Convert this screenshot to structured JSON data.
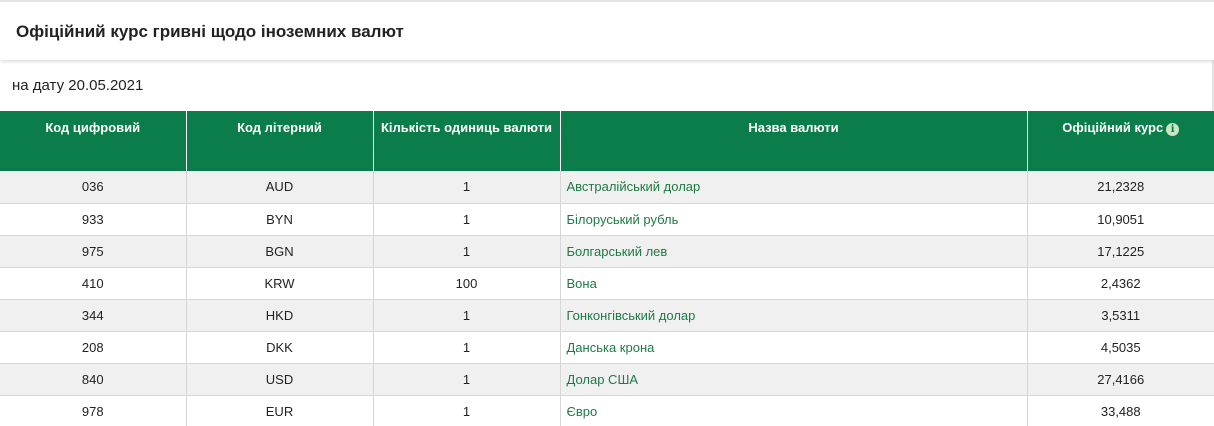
{
  "header": {
    "title": "Офіційний курс гривні щодо іноземних валют"
  },
  "date_line": "на дату 20.05.2021",
  "colors": {
    "header_green": "#0b7d4a",
    "link_green": "#1f7a45",
    "row_stripe": "#f0f0f0"
  },
  "table": {
    "columns": [
      "Код цифровий",
      "Код літерний",
      "Кількість одиниць валюти",
      "Назва валюти",
      "Офіційний курс"
    ],
    "info_icon": "info-icon",
    "info_glyph": "i",
    "rows": [
      {
        "code_num": "036",
        "code_alpha": "AUD",
        "units": "1",
        "name": "Австралійський долар",
        "rate": "21,2328"
      },
      {
        "code_num": "933",
        "code_alpha": "BYN",
        "units": "1",
        "name": "Білоруський рубль",
        "rate": "10,9051"
      },
      {
        "code_num": "975",
        "code_alpha": "BGN",
        "units": "1",
        "name": "Болгарський лев",
        "rate": "17,1225"
      },
      {
        "code_num": "410",
        "code_alpha": "KRW",
        "units": "100",
        "name": "Вона",
        "rate": "2,4362"
      },
      {
        "code_num": "344",
        "code_alpha": "HKD",
        "units": "1",
        "name": "Гонконгівський долар",
        "rate": "3,5311"
      },
      {
        "code_num": "208",
        "code_alpha": "DKK",
        "units": "1",
        "name": "Данська крона",
        "rate": "4,5035"
      },
      {
        "code_num": "840",
        "code_alpha": "USD",
        "units": "1",
        "name": "Долар США",
        "rate": "27,4166"
      },
      {
        "code_num": "978",
        "code_alpha": "EUR",
        "units": "1",
        "name": "Євро",
        "rate": "33,488"
      }
    ]
  }
}
